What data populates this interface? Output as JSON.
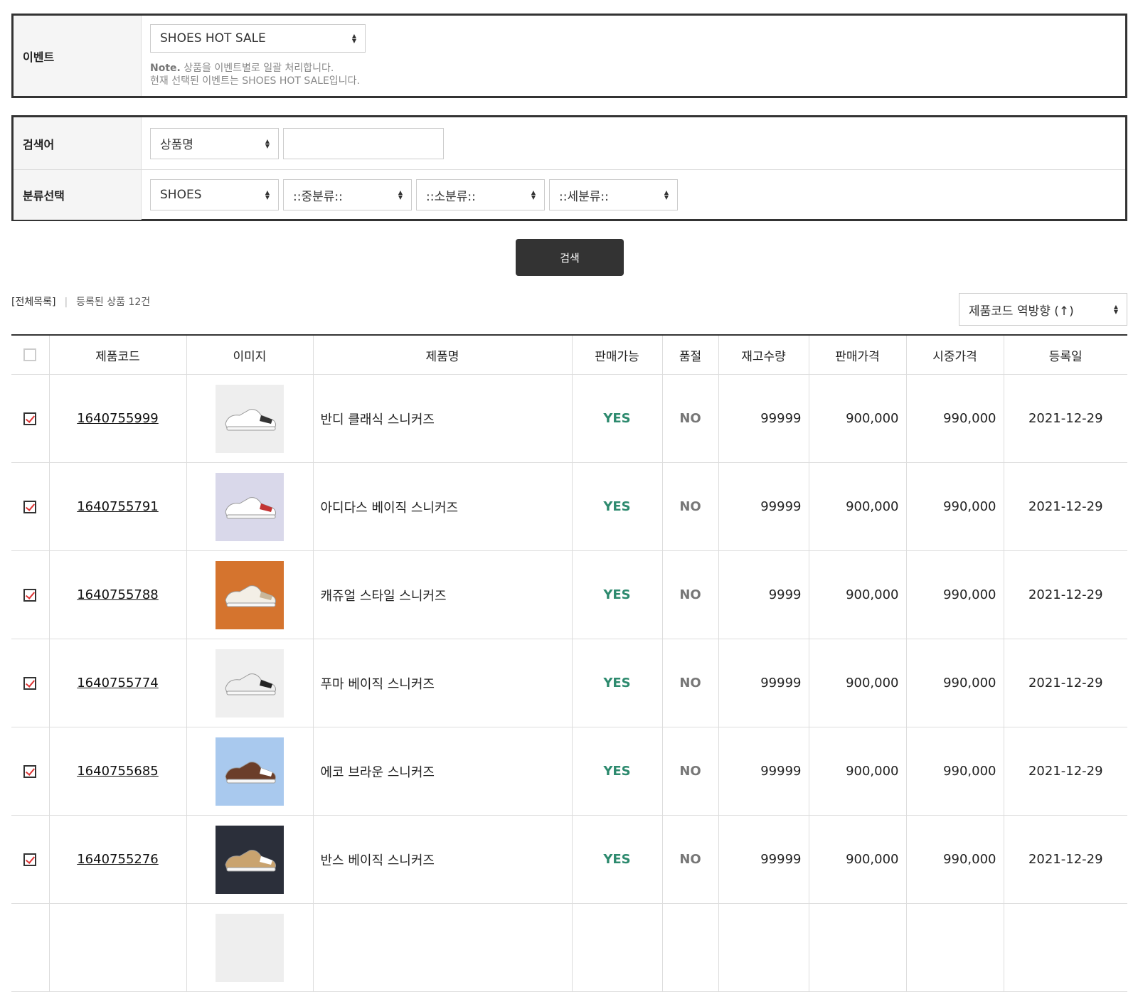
{
  "event": {
    "label": "이벤트",
    "selected": "SHOES HOT SALE",
    "note_bold": "Note.",
    "note_line1": " 상품을 이벤트별로 일괄 처리합니다.",
    "note_line2": "현재 선택된 이벤트는 SHOES HOT SALE입니다."
  },
  "search": {
    "keyword_label": "검색어",
    "keyword_type": "상품명",
    "keyword_value": "",
    "category_label": "분류선택",
    "cat1": "SHOES",
    "cat2": "::중분류::",
    "cat3": "::소분류::",
    "cat4": "::세분류::",
    "button": "검색"
  },
  "list": {
    "title": "[전체목록]",
    "count_text": "등록된 상품 12건",
    "sort": "제품코드 역방향 (↑)"
  },
  "table": {
    "headers": [
      "제품코드",
      "이미지",
      "제품명",
      "판매가능",
      "품절",
      "재고수량",
      "판매가격",
      "시중가격",
      "등록일"
    ],
    "rows": [
      {
        "code": "1640755999",
        "name": "반디 클래식 스니커즈",
        "sale": "YES",
        "soldout": "NO",
        "stock": "99999",
        "price": "900,000",
        "market": "990,000",
        "date": "2021-12-29",
        "thumb_bg": "#eeeeee",
        "shoe": "#ffffff",
        "accent": "#333333"
      },
      {
        "code": "1640755791",
        "name": "아디다스 베이직 스니커즈",
        "sale": "YES",
        "soldout": "NO",
        "stock": "99999",
        "price": "900,000",
        "market": "990,000",
        "date": "2021-12-29",
        "thumb_bg": "#d9d8ea",
        "shoe": "#ffffff",
        "accent": "#c33333"
      },
      {
        "code": "1640755788",
        "name": "캐쥬얼 스타일 스니커즈",
        "sale": "YES",
        "soldout": "NO",
        "stock": "9999",
        "price": "900,000",
        "market": "990,000",
        "date": "2021-12-29",
        "thumb_bg": "#d5742e",
        "shoe": "#f3efe6",
        "accent": "#c9b79a"
      },
      {
        "code": "1640755774",
        "name": "푸마 베이직 스니커즈",
        "sale": "YES",
        "soldout": "NO",
        "stock": "99999",
        "price": "900,000",
        "market": "990,000",
        "date": "2021-12-29",
        "thumb_bg": "#efefef",
        "shoe": "#eeeeee",
        "accent": "#222222"
      },
      {
        "code": "1640755685",
        "name": "에코 브라운 스니커즈",
        "sale": "YES",
        "soldout": "NO",
        "stock": "99999",
        "price": "900,000",
        "market": "990,000",
        "date": "2021-12-29",
        "thumb_bg": "#a9c9ee",
        "shoe": "#6b3e2a",
        "accent": "#ffffff"
      },
      {
        "code": "1640755276",
        "name": "반스 베이직 스니커즈",
        "sale": "YES",
        "soldout": "NO",
        "stock": "99999",
        "price": "900,000",
        "market": "990,000",
        "date": "2021-12-29",
        "thumb_bg": "#2b2f3a",
        "shoe": "#c9a36f",
        "accent": "#ffffff"
      },
      {
        "code": "",
        "name": "",
        "sale": "",
        "soldout": "",
        "stock": "",
        "price": "",
        "market": "",
        "date": "",
        "thumb_bg": "#eeeeee",
        "shoe": "#eeeeee",
        "accent": "#eeeeee"
      }
    ]
  }
}
